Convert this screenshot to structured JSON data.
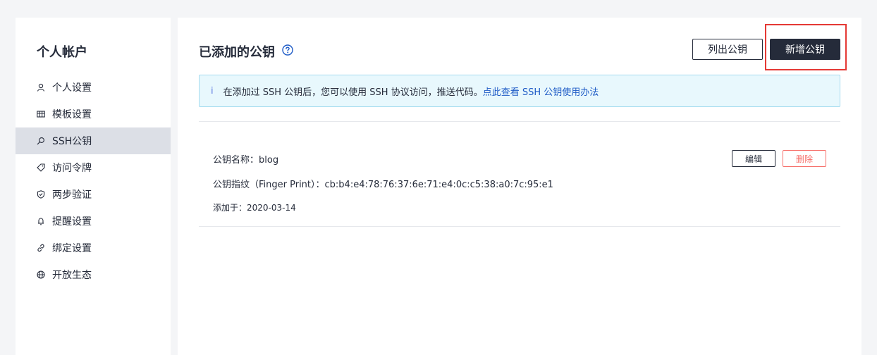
{
  "sidebar": {
    "title": "个人帐户",
    "items": [
      {
        "label": "个人设置",
        "icon": "user-icon"
      },
      {
        "label": "模板设置",
        "icon": "template-icon"
      },
      {
        "label": "SSH公钥",
        "icon": "search-key-icon",
        "active": true
      },
      {
        "label": "访问令牌",
        "icon": "tag-icon"
      },
      {
        "label": "两步验证",
        "icon": "shield-icon"
      },
      {
        "label": "提醒设置",
        "icon": "bell-icon"
      },
      {
        "label": "绑定设置",
        "icon": "link-icon"
      },
      {
        "label": "开放生态",
        "icon": "globe-icon"
      }
    ]
  },
  "header": {
    "title": "已添加的公钥",
    "list_button": "列出公钥",
    "add_button": "新增公钥"
  },
  "info": {
    "icon_glyph": "i",
    "text": "在添加过 SSH 公钥后，您可以使用 SSH 协议访问，推送代码。",
    "link_text": "点此查看 SSH 公钥使用办法"
  },
  "keys": [
    {
      "name_line": "公钥名称：blog",
      "fingerprint_line": "公钥指纹（Finger Print）：cb:b4:e4:78:76:37:6e:71:e4:0c:c5:38:a0:7c:95:e1",
      "added_line": "添加于：2020-03-14",
      "edit_label": "编辑",
      "delete_label": "删除"
    }
  ],
  "colors": {
    "primary": "#252b3a",
    "link": "#1e5bc6",
    "danger": "#f66f6a",
    "info_bg": "#e8f8fd",
    "highlight": "#e53935"
  }
}
